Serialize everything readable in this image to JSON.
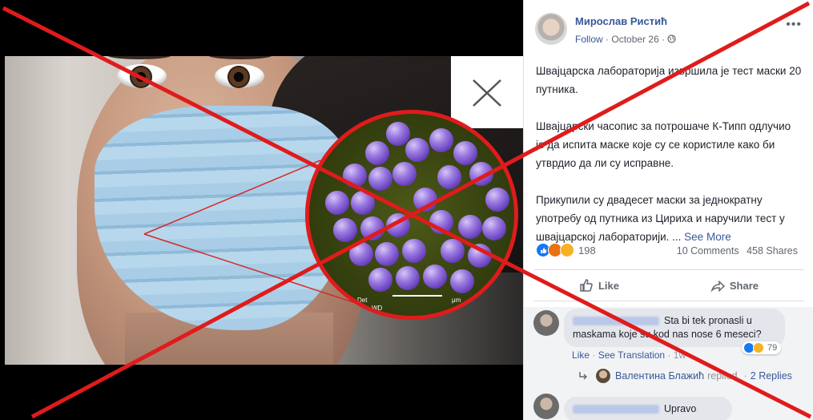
{
  "post": {
    "author": "Мирослав Ристић",
    "follow_label": "Follow",
    "separator": "·",
    "date": "October 26",
    "paragraphs": [
      "Швајцарска лабораторија извршила је тест маски 20 путника.",
      "Швајцарски часопис за потрошаче К-Типп одлучио је да испита маске које су се користиле како би утврдио да ли су исправне.",
      "Прикупили су двадесет маски за једнократну употребу од путника из Цириха и наручили тест у швајцарској лабораторији. ..."
    ],
    "see_more": "See More",
    "reaction_count": "198",
    "comments_count": "10 Comments",
    "shares_count": "458 Shares",
    "like_label": "Like",
    "share_label": "Share"
  },
  "image": {
    "micro_label_left": "Det",
    "micro_label_wd": "WD",
    "micro_label_unit": "μm"
  },
  "comments": [
    {
      "text": "Sta bi tek pronasli u maskama koje su kod nas nose 6 meseci?",
      "like": "Like",
      "see_translation": "See Translation",
      "time": "1w",
      "reactions": "79"
    },
    {
      "text": "Upravo"
    }
  ],
  "replies": {
    "name": "Валентина Блажић",
    "replied": "replied",
    "separator": "·",
    "count": "2 Replies"
  },
  "colors": {
    "overlay_x": "#e01b1b",
    "link": "#385898"
  }
}
